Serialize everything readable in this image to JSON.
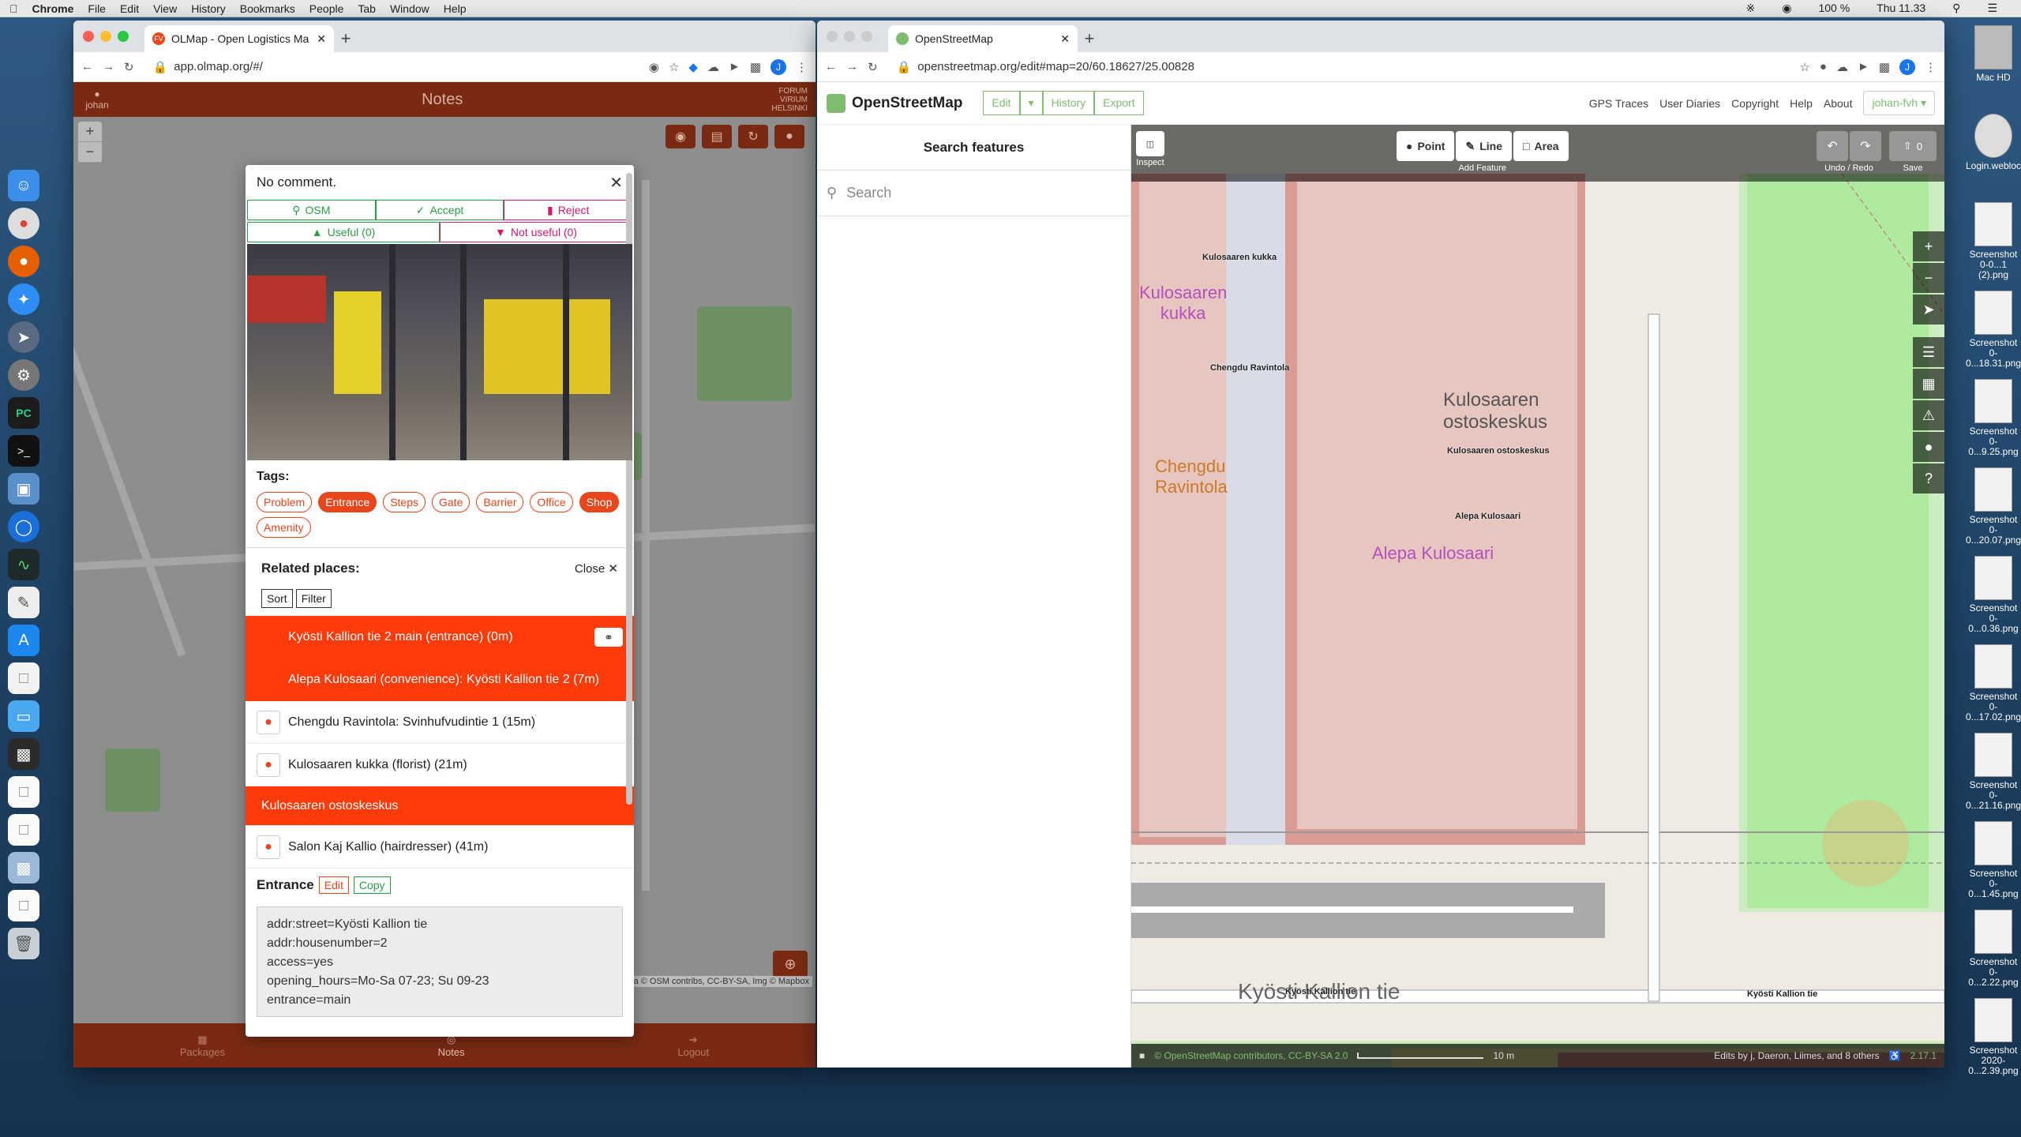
{
  "menubar": {
    "app": "Chrome",
    "items": [
      "File",
      "Edit",
      "View",
      "History",
      "Bookmarks",
      "People",
      "Tab",
      "Window",
      "Help"
    ],
    "battery": "100 %",
    "clock": "Thu 11.33"
  },
  "left_window": {
    "tab_title": "OLMap - Open Logistics Ma",
    "url": "app.olmap.org/#/"
  },
  "olmap": {
    "header": {
      "user": "johan",
      "title": "Notes",
      "brand_line1": "FORUM",
      "brand_line2": "VIRIUM",
      "brand_line3": "HELSINKI"
    },
    "zoom_in": "+",
    "zoom_out": "−",
    "attribution": "Leaflet | Data © OSM contribs, CC-BY-SA, Img © Mapbox",
    "footer": {
      "packages": "Packages",
      "notes": "Notes",
      "logout": "Logout"
    },
    "popup": {
      "comment": "No comment.",
      "buttons": {
        "osm": "OSM",
        "accept": "Accept",
        "reject": "Reject",
        "useful": "Useful (0)",
        "not_useful": "Not useful (0)"
      },
      "tags_label": "Tags:",
      "tags": [
        {
          "label": "Problem",
          "on": false
        },
        {
          "label": "Entrance",
          "on": true
        },
        {
          "label": "Steps",
          "on": false
        },
        {
          "label": "Gate",
          "on": false
        },
        {
          "label": "Barrier",
          "on": false
        },
        {
          "label": "Office",
          "on": false
        },
        {
          "label": "Shop",
          "on": true
        },
        {
          "label": "Amenity",
          "on": false
        }
      ],
      "related_label": "Related places:",
      "close_label": "Close",
      "sort_label": "Sort",
      "filter_label": "Filter",
      "places": [
        "Kyösti Kallion tie 2 main (entrance) (0m)",
        "Alepa Kulosaari (convenience): Kyösti Kallion tie 2 (7m)",
        "Chengdu Ravintola: Svinhufvudintie 1 (15m)",
        "Kulosaaren kukka (florist) (21m)",
        "Kulosaaren ostoskeskus",
        "Salon Kaj Kallio (hairdresser) (41m)"
      ],
      "entrance_label": "Entrance",
      "edit_label": "Edit",
      "copy_label": "Copy",
      "osm_tags": [
        "addr:street=Kyösti Kallion tie",
        "addr:housenumber=2",
        "access=yes",
        "opening_hours=Mo-Sa 07-23; Su 09-23",
        "entrance=main"
      ]
    }
  },
  "right_window": {
    "tab_title": "OpenStreetMap",
    "url": "openstreetmap.org/edit#map=20/60.18627/25.00828"
  },
  "osm": {
    "logo": "OpenStreetMap",
    "edit": "Edit",
    "history": "History",
    "export": "Export",
    "nav": [
      "GPS Traces",
      "User Diaries",
      "Copyright",
      "Help",
      "About"
    ],
    "user": "johan-fvh",
    "side_title": "Search features",
    "search_placeholder": "Search",
    "inspect": "Inspect",
    "point": "Point",
    "line": "Line",
    "area": "Area",
    "add_feature": "Add Feature",
    "undo_redo": "Undo / Redo",
    "save": "Save",
    "save_count": "0",
    "scale": "10 m",
    "edits_by": "Edits by j, Daeron, Liimes, and 8 others",
    "version": "2.17.1",
    "attribution": "© OpenStreetMap contributors, CC-BY-SA 2.0",
    "labels": {
      "kukka_small": "Kulosaaren kukka",
      "kukka_big1": "Kulosaaren",
      "kukka_big2": "kukka",
      "chengdu_small": "Chengdu Ravintola",
      "chengdu_big1": "Chengdu",
      "chengdu_big2": "Ravintola",
      "ostos_big1": "Kulosaaren",
      "ostos_big2": "ostoskeskus",
      "ostos_small": "Kulosaaren ostoskeskus",
      "alepa_small": "Alepa Kulosaari",
      "alepa_big": "Alepa Kulosaari",
      "street1": "Kyösti Kallion tie",
      "street2": "Kyösti Kallion tie",
      "street_big": "Kyösti Kallion tie"
    }
  },
  "desktop_files": [
    "Mac HD",
    "Login.webloc",
    "Screenshot 0-0...1 (2).png",
    "Screenshot 0-0...18.31.png",
    "Screenshot 0-0...9.25.png",
    "Screenshot 0-0...20.07.png",
    "Screenshot 0-0...0.36.png",
    "Screenshot 0-0...17.02.png",
    "Screenshot 0-0...21.16.png",
    "Screenshot 0-0...1.45.png",
    "Screenshot 0-0...2.22.png",
    "Screenshot 2020-0...2.39.png"
  ],
  "colors": {
    "olmap_accent": "#ff3b0a",
    "osm_green": "#7ebc6f",
    "accept_green": "#2a9d43",
    "reject_pink": "#d01a6f"
  }
}
